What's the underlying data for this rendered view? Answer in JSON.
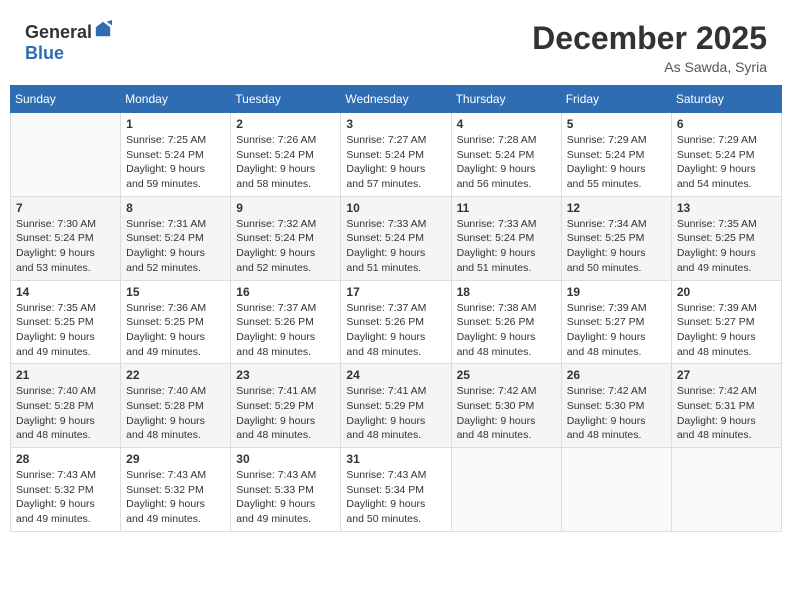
{
  "header": {
    "logo_general": "General",
    "logo_blue": "Blue",
    "month": "December 2025",
    "location": "As Sawda, Syria"
  },
  "weekdays": [
    "Sunday",
    "Monday",
    "Tuesday",
    "Wednesday",
    "Thursday",
    "Friday",
    "Saturday"
  ],
  "weeks": [
    [
      {
        "date": "",
        "info": ""
      },
      {
        "date": "1",
        "info": "Sunrise: 7:25 AM\nSunset: 5:24 PM\nDaylight: 9 hours\nand 59 minutes."
      },
      {
        "date": "2",
        "info": "Sunrise: 7:26 AM\nSunset: 5:24 PM\nDaylight: 9 hours\nand 58 minutes."
      },
      {
        "date": "3",
        "info": "Sunrise: 7:27 AM\nSunset: 5:24 PM\nDaylight: 9 hours\nand 57 minutes."
      },
      {
        "date": "4",
        "info": "Sunrise: 7:28 AM\nSunset: 5:24 PM\nDaylight: 9 hours\nand 56 minutes."
      },
      {
        "date": "5",
        "info": "Sunrise: 7:29 AM\nSunset: 5:24 PM\nDaylight: 9 hours\nand 55 minutes."
      },
      {
        "date": "6",
        "info": "Sunrise: 7:29 AM\nSunset: 5:24 PM\nDaylight: 9 hours\nand 54 minutes."
      }
    ],
    [
      {
        "date": "7",
        "info": "Sunrise: 7:30 AM\nSunset: 5:24 PM\nDaylight: 9 hours\nand 53 minutes."
      },
      {
        "date": "8",
        "info": "Sunrise: 7:31 AM\nSunset: 5:24 PM\nDaylight: 9 hours\nand 52 minutes."
      },
      {
        "date": "9",
        "info": "Sunrise: 7:32 AM\nSunset: 5:24 PM\nDaylight: 9 hours\nand 52 minutes."
      },
      {
        "date": "10",
        "info": "Sunrise: 7:33 AM\nSunset: 5:24 PM\nDaylight: 9 hours\nand 51 minutes."
      },
      {
        "date": "11",
        "info": "Sunrise: 7:33 AM\nSunset: 5:24 PM\nDaylight: 9 hours\nand 51 minutes."
      },
      {
        "date": "12",
        "info": "Sunrise: 7:34 AM\nSunset: 5:25 PM\nDaylight: 9 hours\nand 50 minutes."
      },
      {
        "date": "13",
        "info": "Sunrise: 7:35 AM\nSunset: 5:25 PM\nDaylight: 9 hours\nand 49 minutes."
      }
    ],
    [
      {
        "date": "14",
        "info": "Sunrise: 7:35 AM\nSunset: 5:25 PM\nDaylight: 9 hours\nand 49 minutes."
      },
      {
        "date": "15",
        "info": "Sunrise: 7:36 AM\nSunset: 5:25 PM\nDaylight: 9 hours\nand 49 minutes."
      },
      {
        "date": "16",
        "info": "Sunrise: 7:37 AM\nSunset: 5:26 PM\nDaylight: 9 hours\nand 48 minutes."
      },
      {
        "date": "17",
        "info": "Sunrise: 7:37 AM\nSunset: 5:26 PM\nDaylight: 9 hours\nand 48 minutes."
      },
      {
        "date": "18",
        "info": "Sunrise: 7:38 AM\nSunset: 5:26 PM\nDaylight: 9 hours\nand 48 minutes."
      },
      {
        "date": "19",
        "info": "Sunrise: 7:39 AM\nSunset: 5:27 PM\nDaylight: 9 hours\nand 48 minutes."
      },
      {
        "date": "20",
        "info": "Sunrise: 7:39 AM\nSunset: 5:27 PM\nDaylight: 9 hours\nand 48 minutes."
      }
    ],
    [
      {
        "date": "21",
        "info": "Sunrise: 7:40 AM\nSunset: 5:28 PM\nDaylight: 9 hours\nand 48 minutes."
      },
      {
        "date": "22",
        "info": "Sunrise: 7:40 AM\nSunset: 5:28 PM\nDaylight: 9 hours\nand 48 minutes."
      },
      {
        "date": "23",
        "info": "Sunrise: 7:41 AM\nSunset: 5:29 PM\nDaylight: 9 hours\nand 48 minutes."
      },
      {
        "date": "24",
        "info": "Sunrise: 7:41 AM\nSunset: 5:29 PM\nDaylight: 9 hours\nand 48 minutes."
      },
      {
        "date": "25",
        "info": "Sunrise: 7:42 AM\nSunset: 5:30 PM\nDaylight: 9 hours\nand 48 minutes."
      },
      {
        "date": "26",
        "info": "Sunrise: 7:42 AM\nSunset: 5:30 PM\nDaylight: 9 hours\nand 48 minutes."
      },
      {
        "date": "27",
        "info": "Sunrise: 7:42 AM\nSunset: 5:31 PM\nDaylight: 9 hours\nand 48 minutes."
      }
    ],
    [
      {
        "date": "28",
        "info": "Sunrise: 7:43 AM\nSunset: 5:32 PM\nDaylight: 9 hours\nand 49 minutes."
      },
      {
        "date": "29",
        "info": "Sunrise: 7:43 AM\nSunset: 5:32 PM\nDaylight: 9 hours\nand 49 minutes."
      },
      {
        "date": "30",
        "info": "Sunrise: 7:43 AM\nSunset: 5:33 PM\nDaylight: 9 hours\nand 49 minutes."
      },
      {
        "date": "31",
        "info": "Sunrise: 7:43 AM\nSunset: 5:34 PM\nDaylight: 9 hours\nand 50 minutes."
      },
      {
        "date": "",
        "info": ""
      },
      {
        "date": "",
        "info": ""
      },
      {
        "date": "",
        "info": ""
      }
    ]
  ]
}
